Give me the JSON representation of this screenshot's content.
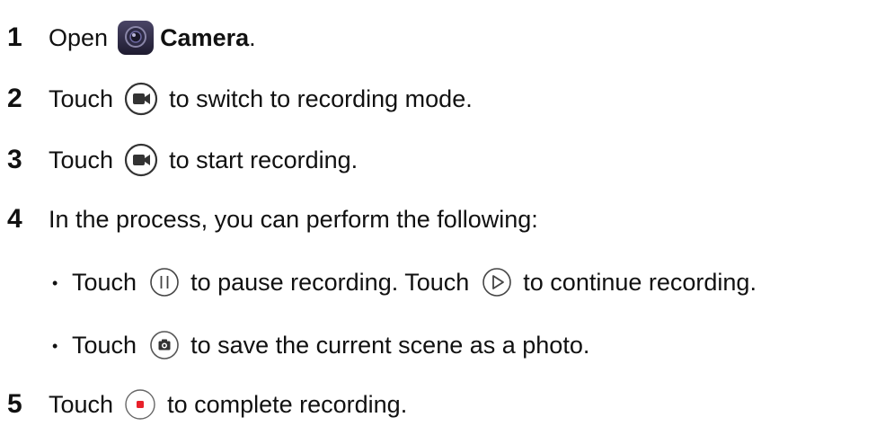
{
  "steps": [
    {
      "number": "1",
      "text_before": "Open",
      "app_name": "Camera",
      "text_after": "."
    },
    {
      "number": "2",
      "text_before": "Touch",
      "text_after": "to switch to recording mode."
    },
    {
      "number": "3",
      "text_before": "Touch",
      "text_after": "to start recording."
    },
    {
      "number": "4",
      "text": "In the process, you can perform the following:"
    },
    {
      "number": "5",
      "text_before": "Touch",
      "text_after": "to complete recording."
    }
  ],
  "bullets": [
    {
      "text_before": "Touch",
      "text_middle": "to pause recording. Touch",
      "text_after": "to continue recording."
    },
    {
      "text_before": "Touch",
      "text_after": "to save the current scene as a photo."
    }
  ],
  "bullet_char": "•",
  "icons": {
    "camera_app": "camera-app-icon",
    "video_mode": "video-camera-icon",
    "record": "video-camera-icon",
    "pause": "pause-icon",
    "play": "play-icon",
    "snapshot": "camera-icon",
    "stop": "stop-record-icon"
  },
  "colors": {
    "text": "#111111",
    "icon_outline": "#333333",
    "record_red": "#e8202a",
    "app_icon_bg": "#2a2740"
  }
}
